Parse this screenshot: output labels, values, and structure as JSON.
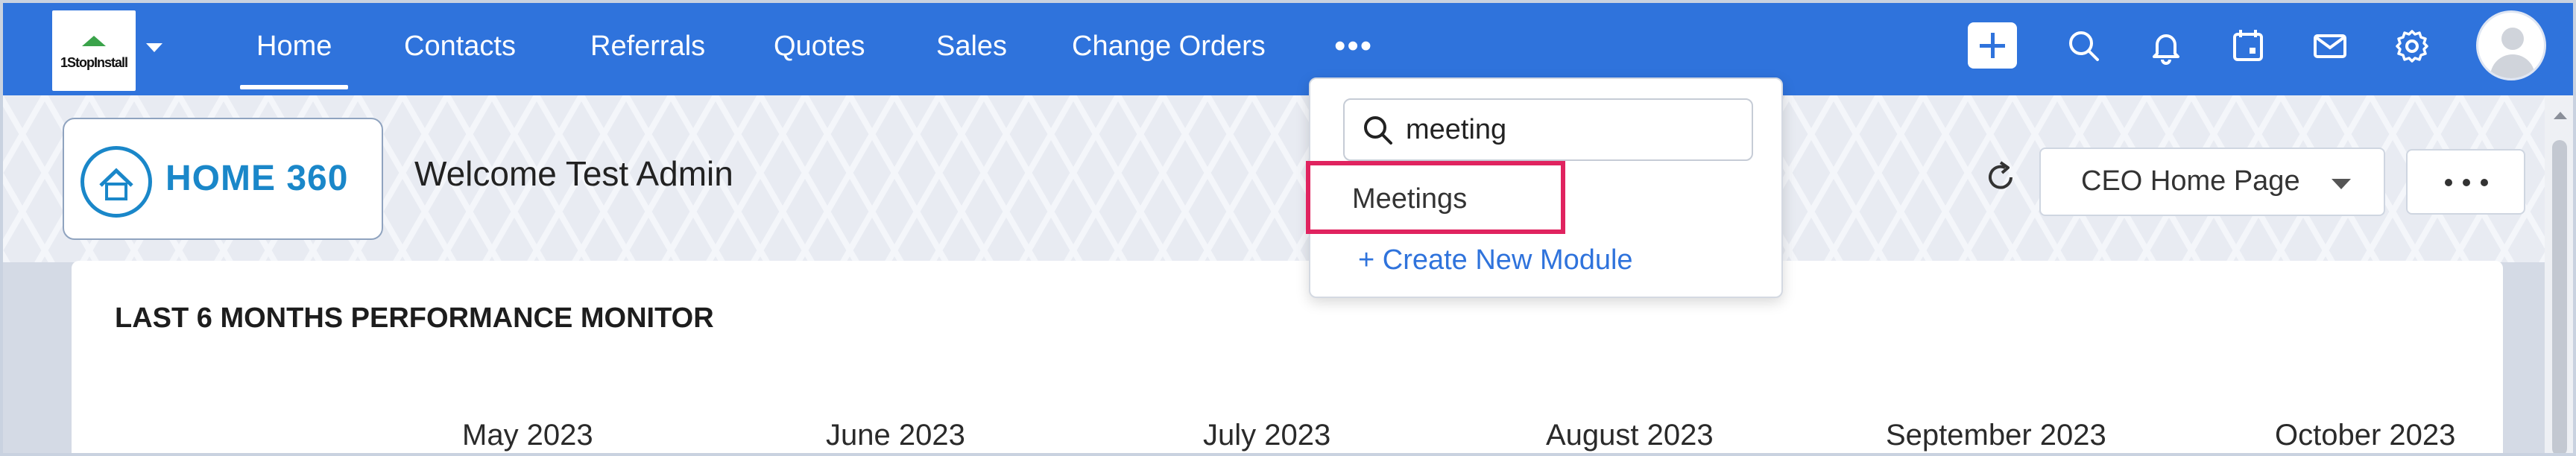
{
  "app": {
    "logo_text": "1StopInstall",
    "brand_color": "#2f73dc"
  },
  "nav": {
    "tabs": [
      {
        "label": "Home",
        "active": true
      },
      {
        "label": "Contacts"
      },
      {
        "label": "Referrals"
      },
      {
        "label": "Quotes"
      },
      {
        "label": "Sales"
      },
      {
        "label": "Change Orders"
      }
    ],
    "more_label": "•••",
    "icons": [
      "plus-icon",
      "search-icon",
      "bell-icon",
      "calendar-icon",
      "mail-icon",
      "gear-icon",
      "avatar"
    ]
  },
  "hero": {
    "logo_text": "HOME 360",
    "welcome": "Welcome Test Admin",
    "home_page_select": "CEO Home Page",
    "more_icon": "ellipsis-icon"
  },
  "dropdown": {
    "search_value": "meeting",
    "result": "Meetings",
    "create_link": "+ Create New Module",
    "highlight_color": "#e0235f"
  },
  "card": {
    "title": "LAST 6 MONTHS PERFORMANCE MONITOR",
    "months": [
      "May 2023",
      "June 2023",
      "July 2023",
      "August 2023",
      "September 2023",
      "October 2023"
    ]
  }
}
